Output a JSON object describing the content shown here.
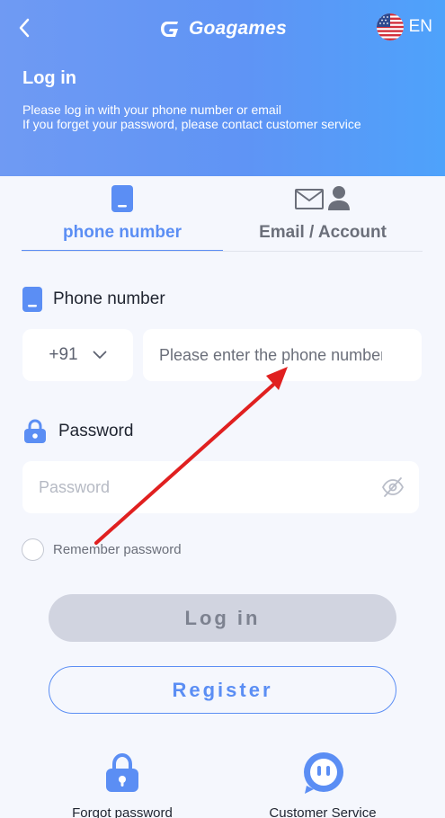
{
  "header": {
    "logo_text": "Goagames",
    "language": "EN",
    "title": "Log in",
    "subtitle_line1": "Please log in with your phone number or email",
    "subtitle_line2": "If you forget your password, please contact customer service"
  },
  "tabs": [
    {
      "label": "phone number",
      "active": true
    },
    {
      "label": "Email / Account",
      "active": false
    }
  ],
  "phone": {
    "label": "Phone number",
    "country_code": "+91",
    "placeholder": "Please enter the phone number"
  },
  "password": {
    "label": "Password",
    "placeholder": "Password"
  },
  "remember_label": "Remember password",
  "buttons": {
    "login": "Log in",
    "register": "Register"
  },
  "footer": {
    "forgot": "Forgot password",
    "customer_service": "Customer Service"
  },
  "colors": {
    "accent": "#5b8ef4",
    "header_start": "#6f9af3",
    "header_end": "#4ea2fb",
    "annotation_arrow": "#e02020"
  }
}
